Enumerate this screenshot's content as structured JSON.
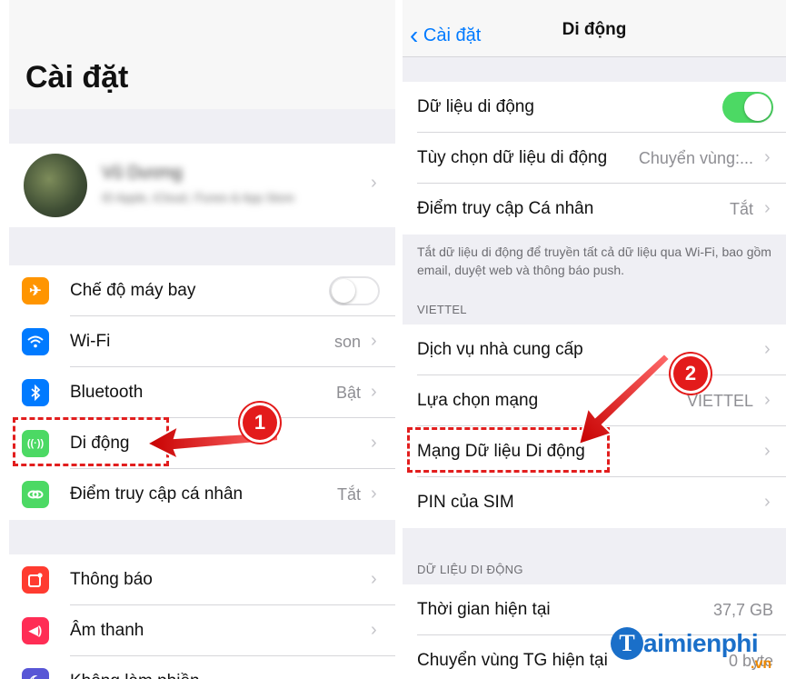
{
  "left": {
    "title": "Cài đặt",
    "profile": {
      "name": "Vũ Dương",
      "subtitle": "ID Apple, iCloud, iTunes & App Store"
    },
    "group1": [
      {
        "label": "Chế độ máy bay",
        "icon": "airplane-icon",
        "color": "#ff9500",
        "toggle": "off"
      },
      {
        "label": "Wi-Fi",
        "icon": "wifi-icon",
        "color": "#007aff",
        "value": "son"
      },
      {
        "label": "Bluetooth",
        "icon": "bluetooth-icon",
        "color": "#007aff",
        "value": "Bật"
      },
      {
        "label": "Di động",
        "icon": "antenna-icon",
        "color": "#4cd964",
        "value": ""
      },
      {
        "label": "Điểm truy cập cá nhân",
        "icon": "hotspot-icon",
        "color": "#4cd964",
        "value": "Tắt"
      }
    ],
    "group2": [
      {
        "label": "Thông báo",
        "icon": "notifications-icon",
        "color": "#ff3b30"
      },
      {
        "label": "Âm thanh",
        "icon": "sound-icon",
        "color": "#ff2d55"
      },
      {
        "label": "Không làm phiền",
        "icon": "moon-icon",
        "color": "#5856d6"
      }
    ],
    "annotation": "1"
  },
  "right": {
    "nav": {
      "back": "Cài đặt",
      "title": "Di động"
    },
    "group1": [
      {
        "label": "Dữ liệu di động",
        "toggle": "on"
      },
      {
        "label": "Tùy chọn dữ liệu di động",
        "value": "Chuyển vùng:..."
      },
      {
        "label": "Điểm truy cập Cá nhân",
        "value": "Tắt"
      }
    ],
    "note": "Tắt dữ liệu di động để truyền tất cả dữ liệu qua Wi-Fi, bao gồm email, duyệt web và thông báo push.",
    "carrier_header": "VIETTEL",
    "group2": [
      {
        "label": "Dịch vụ nhà cung cấp",
        "value": ""
      },
      {
        "label": "Lựa chọn mạng",
        "value": "VIETTEL"
      },
      {
        "label": "Mạng Dữ liệu Di động",
        "value": ""
      },
      {
        "label": "PIN của SIM",
        "value": ""
      }
    ],
    "data_header": "DỮ LIỆU DI ĐỘNG",
    "group3": [
      {
        "label": "Thời gian hiện tại",
        "value": "37,7 GB"
      },
      {
        "label": "Chuyển vùng TG hiện tại",
        "value": "0 byte"
      }
    ],
    "annotation": "2"
  },
  "watermark": {
    "brand": "aimienphi",
    "suffix": ".vn"
  },
  "colors": {
    "accent": "#007aff",
    "highlight": "#e21e1e",
    "toggle_on": "#4cd964"
  }
}
